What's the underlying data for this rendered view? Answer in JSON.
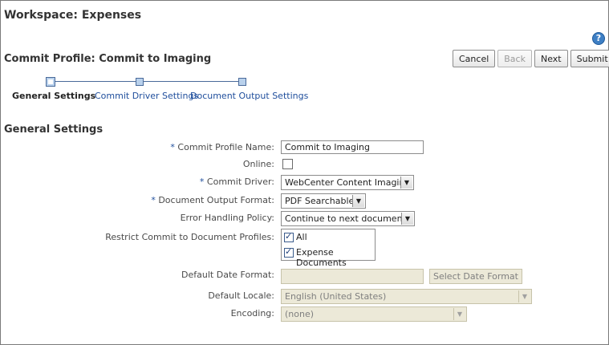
{
  "workspace": {
    "title": "Workspace: Expenses"
  },
  "help": {
    "icon": "help-icon",
    "glyph": "?"
  },
  "profile": {
    "title": "Commit Profile: Commit to Imaging"
  },
  "toolbar": {
    "cancel_label": "Cancel",
    "back_label": "Back",
    "next_label": "Next",
    "submit_label": "Submit"
  },
  "train": {
    "steps": [
      {
        "label": "General Settings",
        "current": true
      },
      {
        "label": "Commit Driver Settings",
        "current": false
      },
      {
        "label": "Document Output Settings",
        "current": false
      }
    ]
  },
  "section": {
    "title": "General Settings"
  },
  "form": {
    "required_marker": "*",
    "profile_name": {
      "label": "Commit Profile Name:",
      "value": "Commit to Imaging"
    },
    "online": {
      "label": "Online:",
      "checked": false
    },
    "commit_driver": {
      "label": "Commit Driver:",
      "value": "WebCenter Content Imaging"
    },
    "output_format": {
      "label": "Document Output Format:",
      "value": "PDF Searchable"
    },
    "error_policy": {
      "label": "Error Handling Policy:",
      "value": "Continue to next document"
    },
    "restrict": {
      "label": "Restrict Commit to Document Profiles:",
      "options": [
        {
          "label": "All",
          "checked": true
        },
        {
          "label": "Expense Documents",
          "checked": true
        }
      ]
    },
    "date_format": {
      "label": "Default Date Format:",
      "value": "",
      "button_label": "Select Date Format"
    },
    "locale": {
      "label": "Default Locale:",
      "value": "English (United States)"
    },
    "encoding": {
      "label": "Encoding:",
      "value": "(none)"
    }
  },
  "colors": {
    "link": "#1f4e9c",
    "required": "#1f4e9c",
    "help": "#3e7fc4",
    "disabled_bg": "#ece9d8"
  }
}
